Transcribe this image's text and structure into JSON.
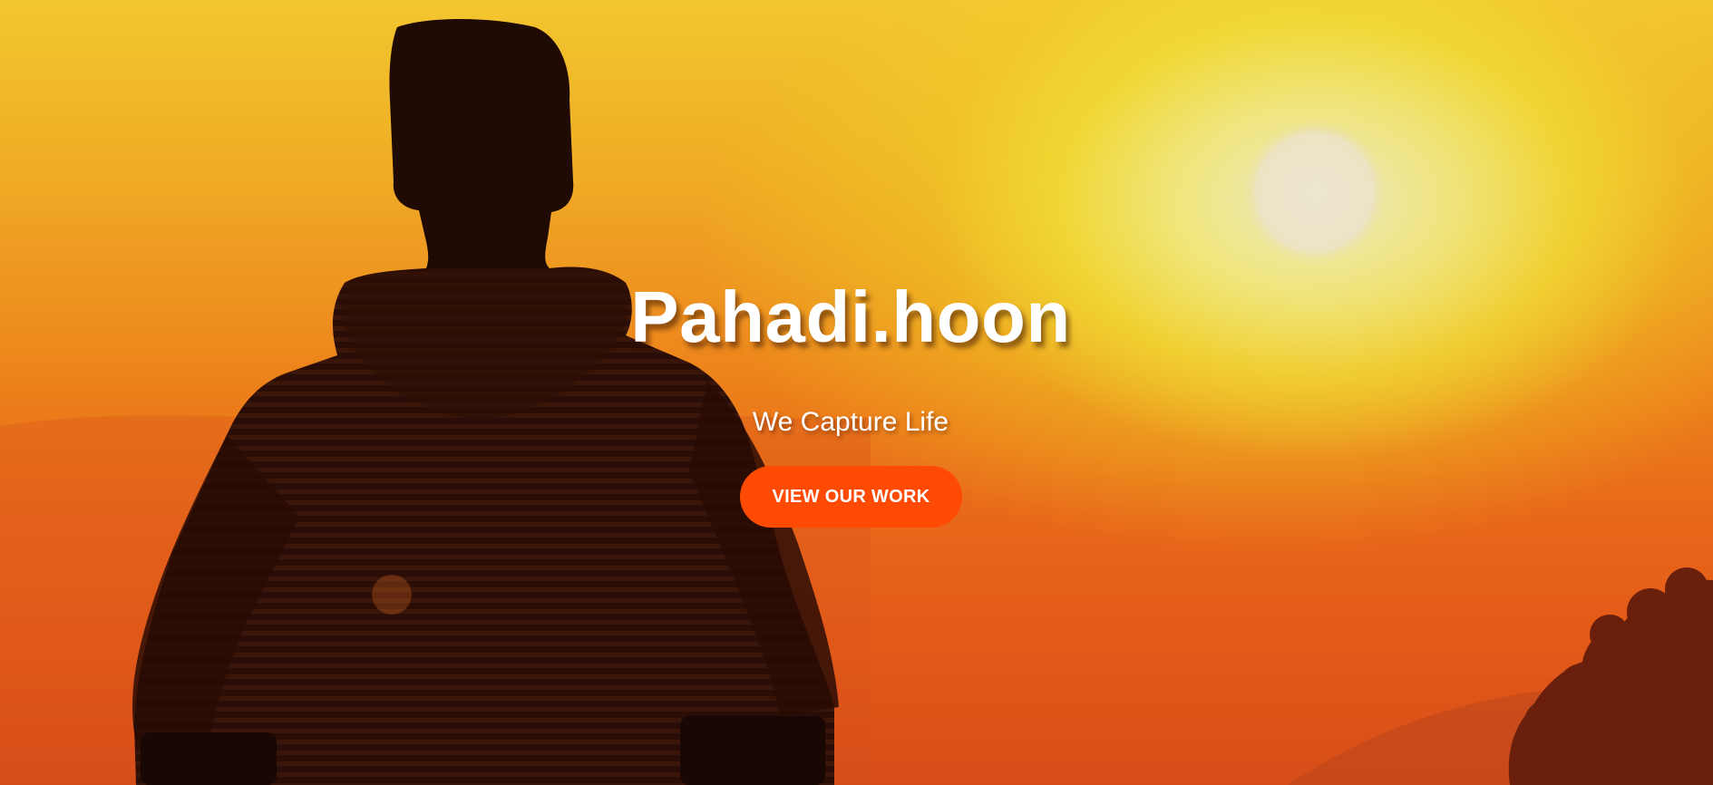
{
  "hero": {
    "title": "Pahadi.hoon",
    "tagline": "We Capture Life",
    "cta_label": "VIEW OUR WORK",
    "background_description": "sunset-silhouette-photo"
  },
  "colors": {
    "cta_background": "#ff4a04",
    "text": "#ffffff",
    "sky_top": "#f2c62f",
    "sky_bottom": "#de5218",
    "silhouette": "#1f0a04"
  }
}
